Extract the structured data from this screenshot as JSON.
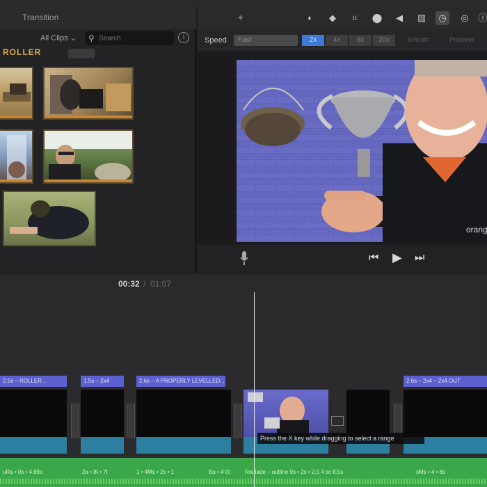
{
  "browser": {
    "tabs": [
      "",
      "Transition"
    ],
    "clips_filter": "All Clips",
    "search_placeholder": "Search",
    "event_name": "ROLLER"
  },
  "viewer": {
    "speed_label": "Speed",
    "speed_value": "Fast",
    "speed_options": [
      "2x",
      "4x",
      "8x",
      "20x"
    ],
    "speed_active": "2x",
    "extra_options": [
      "Smooth",
      "Preserve"
    ]
  },
  "timeline": {
    "current_time": "00:32",
    "separator": "/",
    "total_time": "01:07",
    "clip_labels": [
      "2.5s – ROLLER...",
      "1.5s – 2x4",
      "2.6s – A PROPERLY LEVELLED...",
      "",
      "",
      "2.6s – 2x4 – 2x4 OUT"
    ],
    "tooltip": "Press the X key while dragging to select a range",
    "music_labels": [
      "uRa • 0s • 4.88s",
      "2a • 8t • 7t",
      "1 • 4Ms • 2s • 1",
      "Ba • 4 0t",
      "Roulade – outline 9s • 2s • 2.5 4 sc 8.5s",
      "sMs • 4 • 8s"
    ]
  },
  "colors": {
    "accent": "#3e7bd8",
    "clip_label": "#5c5fcf",
    "audio_clip": "#2d7fa0",
    "music_track": "#3aa84a",
    "event_label": "#d9a94a"
  }
}
